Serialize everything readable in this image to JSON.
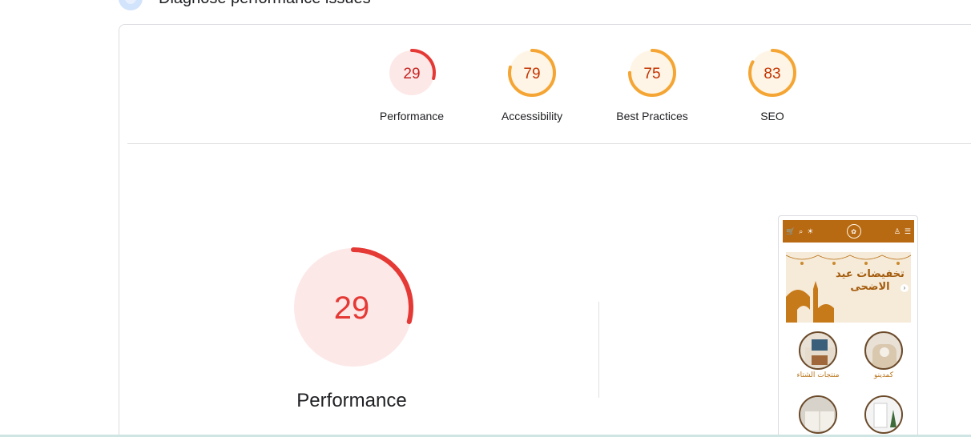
{
  "header": {
    "title": "Diagnose performance issues"
  },
  "scores": [
    {
      "id": "performance",
      "label": "Performance",
      "value": 29,
      "color": "#e53935",
      "fill": "#fde8e8",
      "text_color": "#c5221f"
    },
    {
      "id": "accessibility",
      "label": "Accessibility",
      "value": 79,
      "color": "#f4a533",
      "fill": "#fff5e6",
      "text_color": "#c33300"
    },
    {
      "id": "best-practices",
      "label": "Best Practices",
      "value": 75,
      "color": "#f4a533",
      "fill": "#fff5e6",
      "text_color": "#c33300"
    },
    {
      "id": "seo",
      "label": "SEO",
      "value": 83,
      "color": "#f4a533",
      "fill": "#fff5e6",
      "text_color": "#c33300"
    }
  ],
  "main": {
    "score": 29,
    "label": "Performance",
    "color": "#e53935",
    "fill": "#fde8e8"
  },
  "preview": {
    "banner_text": "تخفيضات عيد الاضحى",
    "categories": [
      {
        "label": "كمدينو"
      },
      {
        "label": "منتجات الشتاء"
      }
    ]
  }
}
